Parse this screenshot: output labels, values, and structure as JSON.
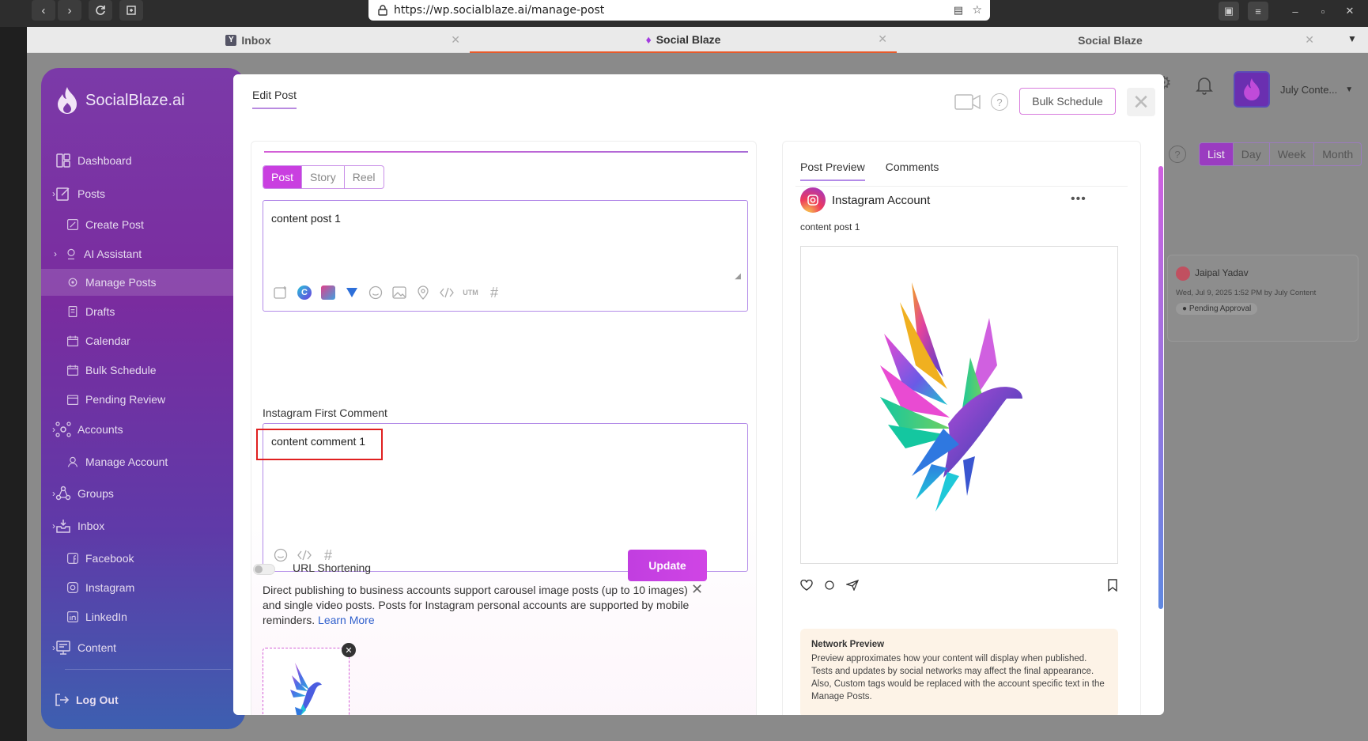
{
  "browser": {
    "url": "https://wp.socialblaze.ai/manage-post",
    "tabs": [
      {
        "label": "Inbox"
      },
      {
        "label": "Social Blaze"
      },
      {
        "label": "Social Blaze"
      }
    ]
  },
  "sidebar": {
    "brand": "SocialBlaze.ai",
    "items": [
      {
        "label": "Dashboard",
        "icon": "dashboard-icon"
      },
      {
        "label": "Posts",
        "icon": "posts-icon"
      },
      {
        "label": "Create Post",
        "icon": "create-post-icon"
      },
      {
        "label": "AI Assistant",
        "icon": "ai-assistant-icon"
      },
      {
        "label": "Manage Posts",
        "icon": "manage-posts-icon"
      },
      {
        "label": "Drafts",
        "icon": "drafts-icon"
      },
      {
        "label": "Calendar",
        "icon": "calendar-icon"
      },
      {
        "label": "Bulk Schedule",
        "icon": "bulk-schedule-icon"
      },
      {
        "label": "Pending Review",
        "icon": "pending-review-icon"
      },
      {
        "label": "Accounts",
        "icon": "accounts-icon"
      },
      {
        "label": "Manage Account",
        "icon": "manage-account-icon"
      },
      {
        "label": "Groups",
        "icon": "groups-icon"
      },
      {
        "label": "Inbox",
        "icon": "inbox-icon"
      },
      {
        "label": "Facebook",
        "icon": "facebook-icon"
      },
      {
        "label": "Instagram",
        "icon": "instagram-icon"
      },
      {
        "label": "LinkedIn",
        "icon": "linkedin-icon"
      },
      {
        "label": "Content",
        "icon": "content-icon"
      }
    ],
    "logout": "Log Out"
  },
  "header": {
    "user_name": "July Conte..."
  },
  "calendar_view": {
    "tabs": [
      "List",
      "Day",
      "Week",
      "Month"
    ],
    "active": "List",
    "card": {
      "name": "Jaipal Yadav",
      "meta": "Wed, Jul 9, 2025 1:52 PM by July Content",
      "status": "Pending Approval"
    }
  },
  "modal": {
    "title": "Edit Post",
    "bulk_schedule": "Bulk Schedule",
    "post_types": [
      "Post",
      "Story",
      "Reel"
    ],
    "active_type": "Post",
    "content": "content post 1",
    "first_comment_label": "Instagram First Comment",
    "first_comment": "content comment 1",
    "url_shortening": "URL Shortening",
    "update": "Update",
    "note": "Direct publishing to business accounts support carousel image posts (up to 10 images) and single video posts. Posts for Instagram personal accounts are supported by mobile reminders.",
    "learn_more": "Learn More",
    "preview": {
      "tabs": [
        "Post Preview",
        "Comments"
      ],
      "account": "Instagram Account",
      "content": "content post 1",
      "network_title": "Network Preview",
      "network_text": "Preview approximates how your content will display when published. Tests and updates by social networks may affect the final appearance. Also, Custom tags would be replaced with the account specific text in the Manage Posts."
    }
  },
  "colors": {
    "accent": "#c93fe0",
    "highlight_box": "#e02020"
  }
}
